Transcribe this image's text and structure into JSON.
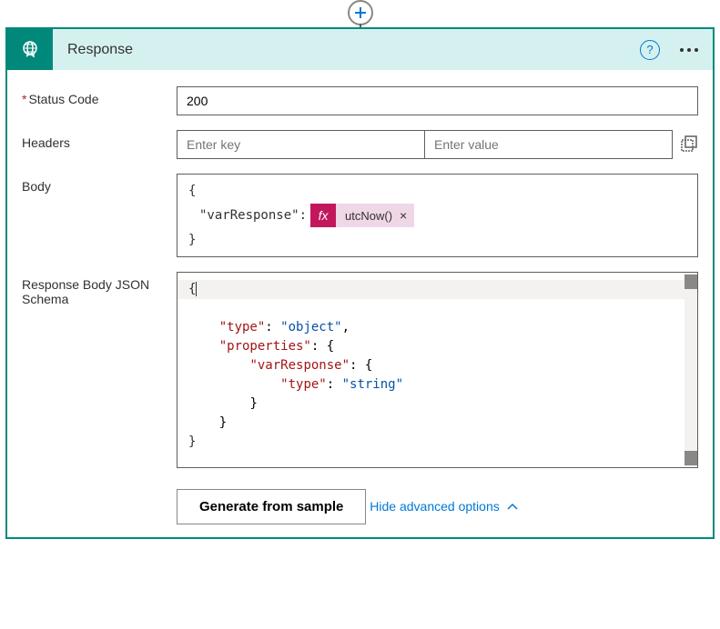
{
  "connector": {
    "title": "Response"
  },
  "fields": {
    "statusCode": {
      "label": "Status Code",
      "value": "200"
    },
    "headers": {
      "label": "Headers",
      "keyPlaceholder": "Enter key",
      "valuePlaceholder": "Enter value"
    },
    "body": {
      "label": "Body",
      "openBrace": "{",
      "property": "\"varResponse\":",
      "tokenFx": "fx",
      "tokenLabel": "utcNow()",
      "closeBrace": "}"
    },
    "schema": {
      "label": "Response Body JSON Schema",
      "line1_open": "{",
      "k_type": "\"type\"",
      "v_object": "\"object\"",
      "k_properties": "\"properties\"",
      "k_varResponse": "\"varResponse\"",
      "v_string": "\"string\"",
      "close": "}"
    }
  },
  "buttons": {
    "generate": "Generate from sample"
  },
  "links": {
    "hideAdvanced": "Hide advanced options"
  }
}
